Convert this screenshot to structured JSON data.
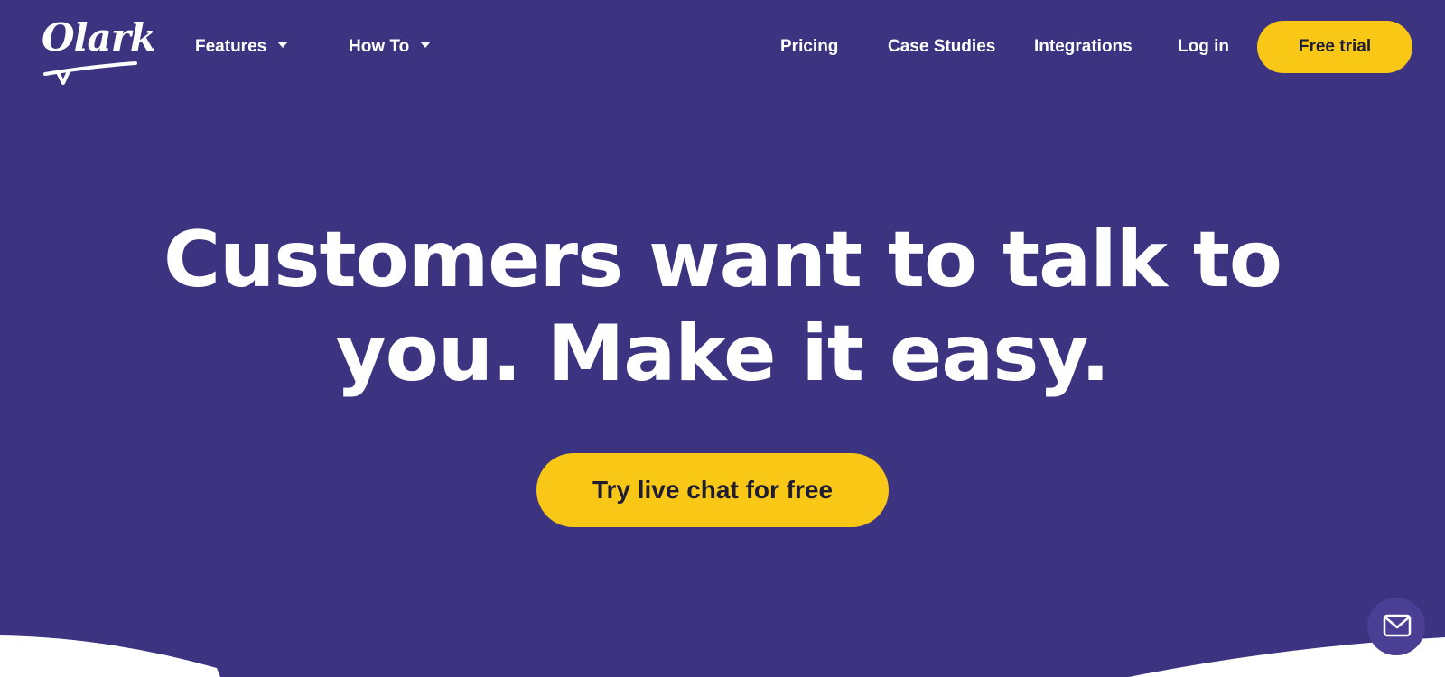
{
  "brand": {
    "logo_text": "Olark",
    "colors": {
      "background": "#3c3480",
      "accent": "#f9c715",
      "text": "#ffffff",
      "button_text": "#1f1d33"
    }
  },
  "nav": {
    "features_label": "Features",
    "howto_label": "How To",
    "pricing_label": "Pricing",
    "case_studies_label": "Case Studies",
    "integrations_label": "Integrations",
    "login_label": "Log in",
    "free_trial_label": "Free trial"
  },
  "hero": {
    "title_line1": "Customers want to talk to",
    "title_line2": "you. Make it easy.",
    "cta_label": "Try live chat for free"
  },
  "chat_widget": {
    "icon": "mail-icon"
  }
}
